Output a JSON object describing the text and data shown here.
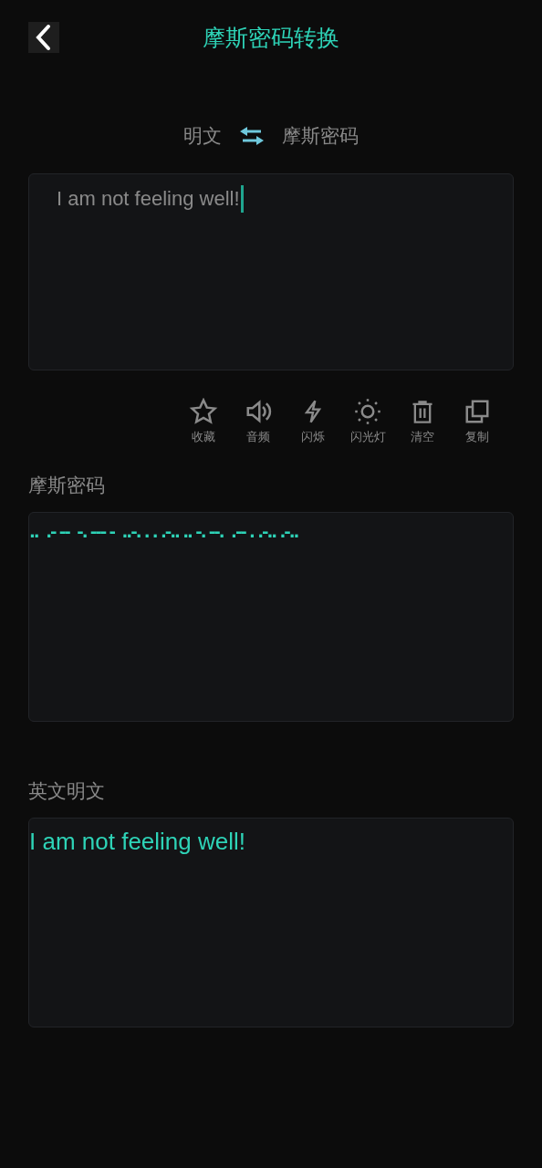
{
  "header": {
    "title": "摩斯密码转换"
  },
  "mode": {
    "from": "明文",
    "to": "摩斯密码"
  },
  "input": {
    "value": "I am not feeling well!"
  },
  "actions": [
    {
      "kind": "star",
      "label": "收藏"
    },
    {
      "kind": "speaker",
      "label": "音频"
    },
    {
      "kind": "bolt",
      "label": "闪烁"
    },
    {
      "kind": "sun",
      "label": "闪光灯"
    },
    {
      "kind": "trash",
      "label": "清空"
    },
    {
      "kind": "copy",
      "label": "复制"
    }
  ],
  "morse": {
    "label": "摩斯密码",
    "value": "..  .- --  -. --- -  ..-. . . .-.. .. -. --.  .-- . .-.. .-.."
  },
  "plain": {
    "label": "英文明文",
    "value": "I am not feeling well!"
  }
}
